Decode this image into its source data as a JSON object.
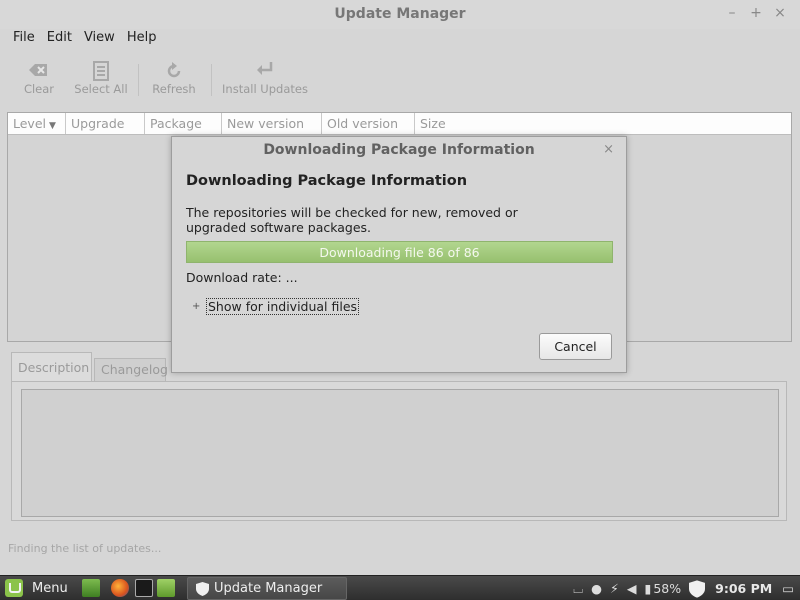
{
  "window": {
    "title": "Update Manager",
    "controls": [
      "–",
      "+",
      "×"
    ]
  },
  "menu": [
    "File",
    "Edit",
    "View",
    "Help"
  ],
  "toolbar": {
    "clear": "Clear",
    "select_all": "Select All",
    "refresh": "Refresh",
    "install": "Install Updates"
  },
  "columns": [
    "Level",
    "Upgrade",
    "Package",
    "New version",
    "Old version",
    "Size"
  ],
  "tabs": {
    "description": "Description",
    "changelog": "Changelog"
  },
  "status": "Finding the list of updates...",
  "dialog": {
    "title": "Downloading Package Information",
    "close": "×",
    "heading": "Downloading Package Information",
    "body": "The repositories will be checked for new, removed or upgraded software packages.",
    "progress_text": "Downloading file 86 of 86",
    "progress_fraction": 1.0,
    "rate": "Download rate: ...",
    "expander_icon": "+",
    "expander_label": "Show for individual files",
    "cancel": "Cancel"
  },
  "taskbar": {
    "menu_label": "Menu",
    "task_label": "Update Manager",
    "battery": "58%",
    "clock": "9:06 PM"
  },
  "icons": [
    "clear-icon",
    "select-all-icon",
    "refresh-icon",
    "install-icon",
    "mint-logo-icon",
    "shield-icon"
  ]
}
